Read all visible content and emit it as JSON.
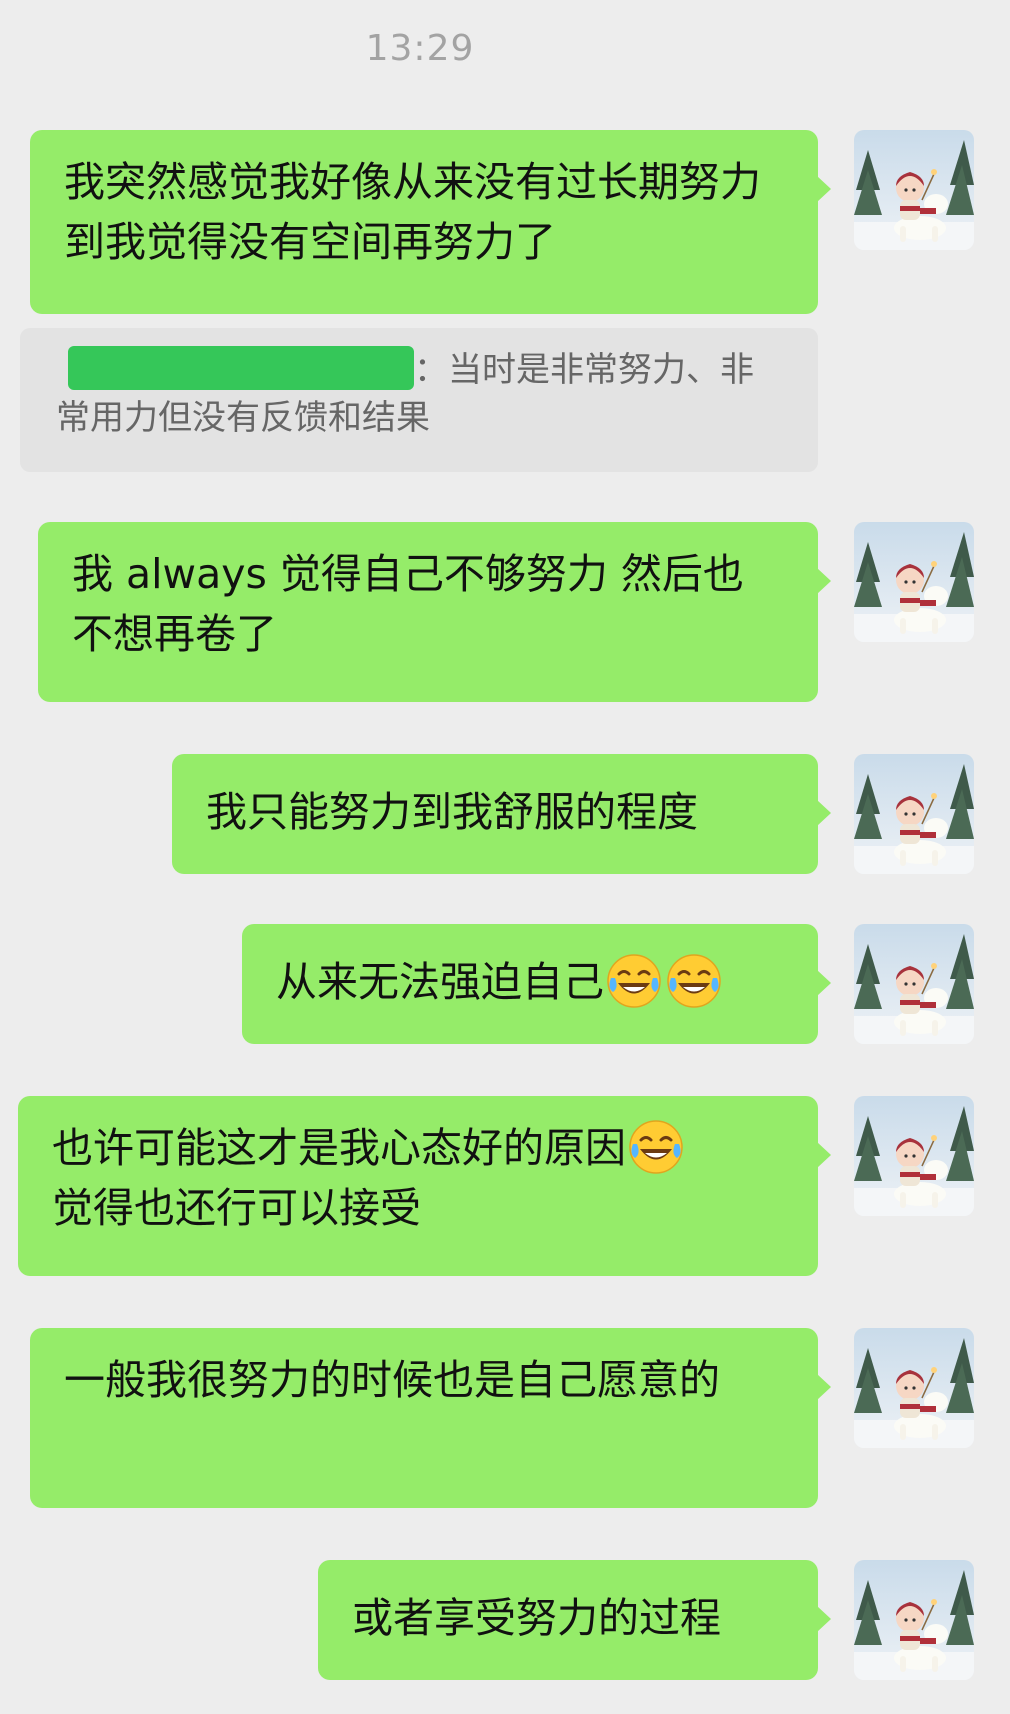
{
  "timestamp": "13:29",
  "messages": [
    {
      "text": "我突然感觉我好像从来没有过长期努力到我觉得没有空间再努力了"
    },
    {
      "text": "我 always 觉得自己不够努力 然后也不想再卷了"
    },
    {
      "text": "我只能努力到我舒服的程度"
    },
    {
      "text": "从来无法强迫自己"
    },
    {
      "text": "也许可能这才是我心态好的原因"
    },
    {
      "text": "觉得也还行可以接受"
    },
    {
      "text": "一般我很努力的时候也是自己愿意的"
    },
    {
      "text": "或者享受努力的过程"
    }
  ],
  "quote": {
    "text_line1": "：当时是非常努力、非",
    "text_line2": "常用力但没有反馈和结果"
  },
  "emoji_names": [
    "face-with-tears-of-joy-icon"
  ],
  "colors": {
    "bubble": "#95ec69",
    "background": "#ededed",
    "redaction": "#35c759"
  }
}
